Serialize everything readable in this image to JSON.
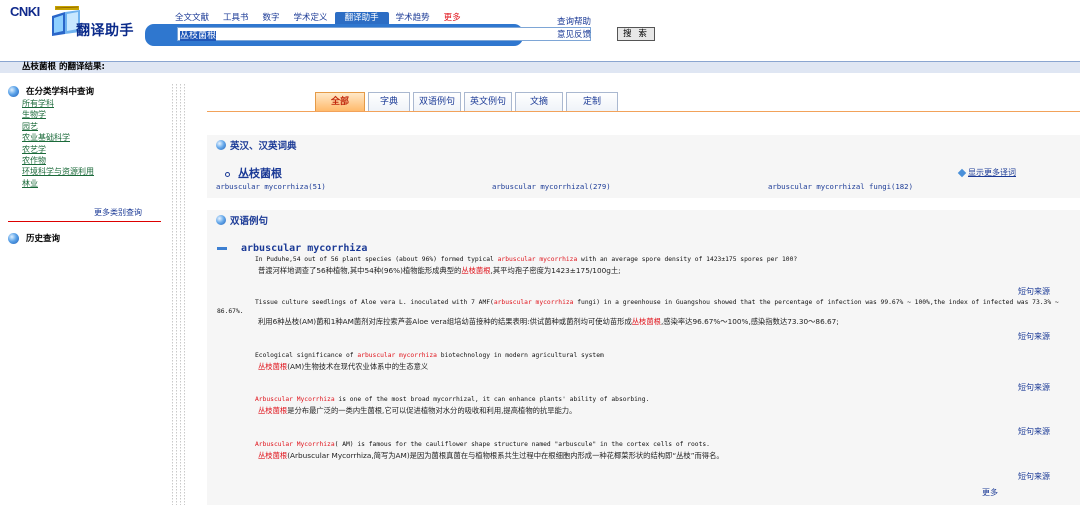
{
  "app": {
    "logo_text": "CNKI",
    "app_name": "翻译助手"
  },
  "nav": {
    "tabs": [
      {
        "label": "全文文献"
      },
      {
        "label": "工具书"
      },
      {
        "label": "数字"
      },
      {
        "label": "学术定义"
      },
      {
        "label": "翻译助手"
      },
      {
        "label": "学术趋势"
      },
      {
        "label": "更多"
      }
    ],
    "active_tab": "翻译助手",
    "help_links": [
      "查询帮助",
      "意见反馈"
    ]
  },
  "search": {
    "query": "丛枝菌根",
    "button_label": "搜 索"
  },
  "result_title": "丛枝菌根 的翻译结果:",
  "sidebar": {
    "category_title": "在分类学科中查询",
    "categories": [
      "所有学科",
      "生物学",
      "园艺",
      "农业基础科学",
      "农艺学",
      "农作物",
      "环境科学与资源利用",
      "林业"
    ],
    "more_label": "更多类别查询",
    "history_title": "历史查询"
  },
  "subtabs": [
    "全部",
    "字典",
    "双语例句",
    "英文例句",
    "文摘",
    "定制"
  ],
  "dictionary": {
    "section_title": "英汉、汉英词典",
    "headword": "丛枝菌根",
    "show_more": "显示更多译词",
    "translations": [
      "arbuscular mycorrhiza(51)",
      "arbuscular mycorrhizal(279)",
      "arbuscular mycorrhizal fungi(182)"
    ]
  },
  "bilingual": {
    "section_title": "双语例句",
    "headword": "arbuscular mycorrhiza",
    "source_label": "短句来源",
    "more_label": "更多",
    "examples": [
      {
        "en": [
          {
            "t": "In Puduhe,54 out of 56 plant species (about 96%) formed typical "
          },
          {
            "t": "arbuscular mycorrhiza",
            "h": true
          },
          {
            "t": " with an average spore density of 1423±175 spores per 100?"
          }
        ],
        "zh": [
          {
            "t": "普渡河样地调查了56种植物,其中54种(96%)植物能形成典型的"
          },
          {
            "t": "丛枝菌根",
            "h": true
          },
          {
            "t": ",其平均孢子密度为1423±175/100g土;"
          }
        ]
      },
      {
        "en": [
          {
            "t": "Tissue culture seedlings of Aloe vera L. inoculated with 7 AMF("
          },
          {
            "t": "arbuscular mycorrhiza",
            "h": true
          },
          {
            "t": " fungi) in a greenhouse in Guangshou showed that the percentage of infection was 99.67% ~ 100%,the index of infected was 73.3% ~ 86.67%."
          }
        ],
        "zh": [
          {
            "t": "利用6种丛枝(AM)菌和1种AM菌剂对库拉索芦荟Aloe vera组培幼苗接种的结果表明:供试菌种或菌剂均可使幼苗形成"
          },
          {
            "t": "丛枝菌根",
            "h": true
          },
          {
            "t": ",感染率达96.67%～100%,感染指数达73.30～86.67;"
          }
        ]
      },
      {
        "en": [
          {
            "t": "Ecological significance of "
          },
          {
            "t": "arbuscular mycorrhiza",
            "h": true
          },
          {
            "t": " biotechnology in modern agricultural system"
          }
        ],
        "zh": [
          {
            "t": "丛枝菌根",
            "h": true
          },
          {
            "t": "(AM)生物技术在现代农业体系中的生态意义"
          }
        ]
      },
      {
        "en": [
          {
            "t": "Arbuscular Mycorrhiza",
            "h": true
          },
          {
            "t": " is one of the most broad mycorrhizal, it can enhance plants' ability of absorbing."
          }
        ],
        "zh": [
          {
            "t": "丛枝菌根",
            "h": true
          },
          {
            "t": "是分布最广泛的一类内生菌根,它可以促进植物对水分的吸收和利用,提高植物的抗旱能力。"
          }
        ]
      },
      {
        "en": [
          {
            "t": "Arbuscular Mycorrhiza",
            "h": true
          },
          {
            "t": "( AM) is famous for the cauliflower shape structure named \"arbuscule\" in the cortex cells of roots."
          }
        ],
        "zh": [
          {
            "t": "丛枝菌根",
            "h": true
          },
          {
            "t": "(Arbuscular Mycorrhiza,简写为AM)是因为菌根真菌在与植物根系共生过程中在根细胞内形成一种花椰菜形状的结构即“丛枝”而得名。"
          }
        ]
      }
    ]
  },
  "colors": {
    "link_blue": "#1b3a96",
    "highlight_red": "#e0141c",
    "active_tab_orange": "#ffb766",
    "header_blue": "#2f77cf"
  }
}
